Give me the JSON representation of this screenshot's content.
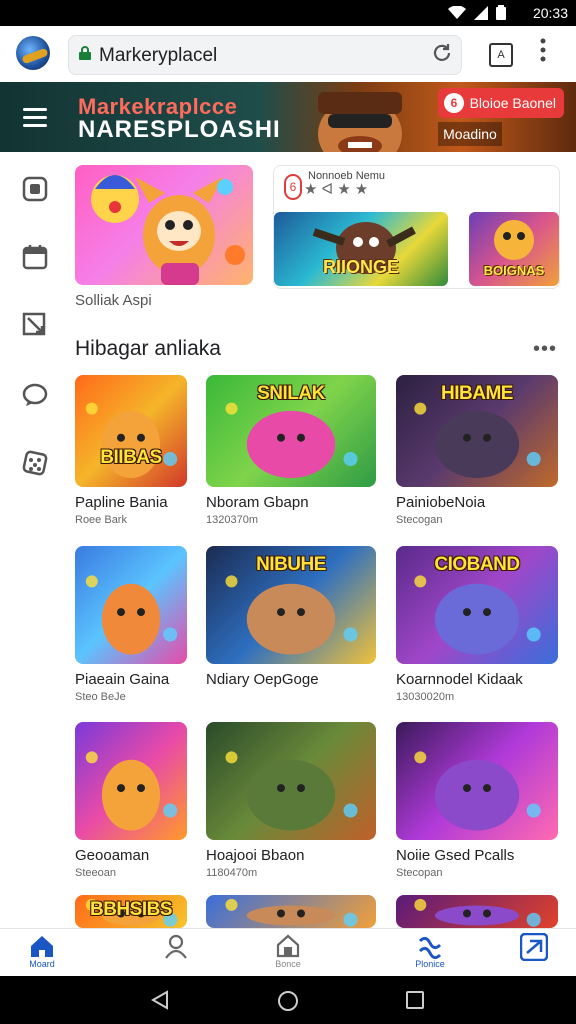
{
  "status": {
    "time": "20:33"
  },
  "browser": {
    "url": "Markeryplacel"
  },
  "hero": {
    "line1": "Markekraplcce",
    "line2": "NARESPLOASHI",
    "badge": "Bloioe Baonel",
    "badge_icon": "6",
    "subbadge": "Moadino"
  },
  "sidebar": {
    "items": [
      {
        "icon": "square-icon"
      },
      {
        "icon": "calendar-icon"
      },
      {
        "icon": "crop-icon"
      },
      {
        "icon": "chat-bubble-icon"
      },
      {
        "icon": "dice-icon"
      }
    ]
  },
  "featured": {
    "caption": "Solliak Aspi"
  },
  "promo": {
    "title": "Nonnoeb   Nemu",
    "stars": "★ ᐊ ★ ★",
    "img1_text": "RIIONGE",
    "img2_text": "BOIGNAS"
  },
  "section": {
    "title": "Hibagar anliaka"
  },
  "games": [
    {
      "title": "Papline Bania",
      "sub": "Roee Bark",
      "art": "BIIBAS"
    },
    {
      "title": "Nboram Gbapn",
      "sub": "1320370m",
      "art": "SNILAK"
    },
    {
      "title": "PainiobeNoia",
      "sub": "Stecogan",
      "art": "HIBAME"
    },
    {
      "title": "Piaeain Gaina",
      "sub": "Steo BeJe",
      "art": ""
    },
    {
      "title": "Ndiary OepGoge",
      "sub": "",
      "art": "NIBUHE"
    },
    {
      "title": "Koarnnodel Kidaak",
      "sub": "13030020m",
      "art": "CIOBAND"
    },
    {
      "title": "Geooaman",
      "sub": "Steeoan",
      "art": ""
    },
    {
      "title": "Hoajooi Bbaon",
      "sub": "1180470m",
      "art": ""
    },
    {
      "title": "Noiie Gsed Pcalls",
      "sub": "Stecopan",
      "art": ""
    },
    {
      "title": "",
      "sub": "",
      "art": "BBHSIBS"
    },
    {
      "title": "",
      "sub": "",
      "art": ""
    },
    {
      "title": "",
      "sub": "",
      "art": ""
    }
  ],
  "bottomnav": [
    {
      "label": "Moard"
    },
    {
      "label": ""
    },
    {
      "label": "Bonce"
    },
    {
      "label": "Plonice"
    },
    {
      "label": ""
    }
  ],
  "colors": {
    "accent": "#1a73e8",
    "hero_red": "#e83a3a"
  }
}
